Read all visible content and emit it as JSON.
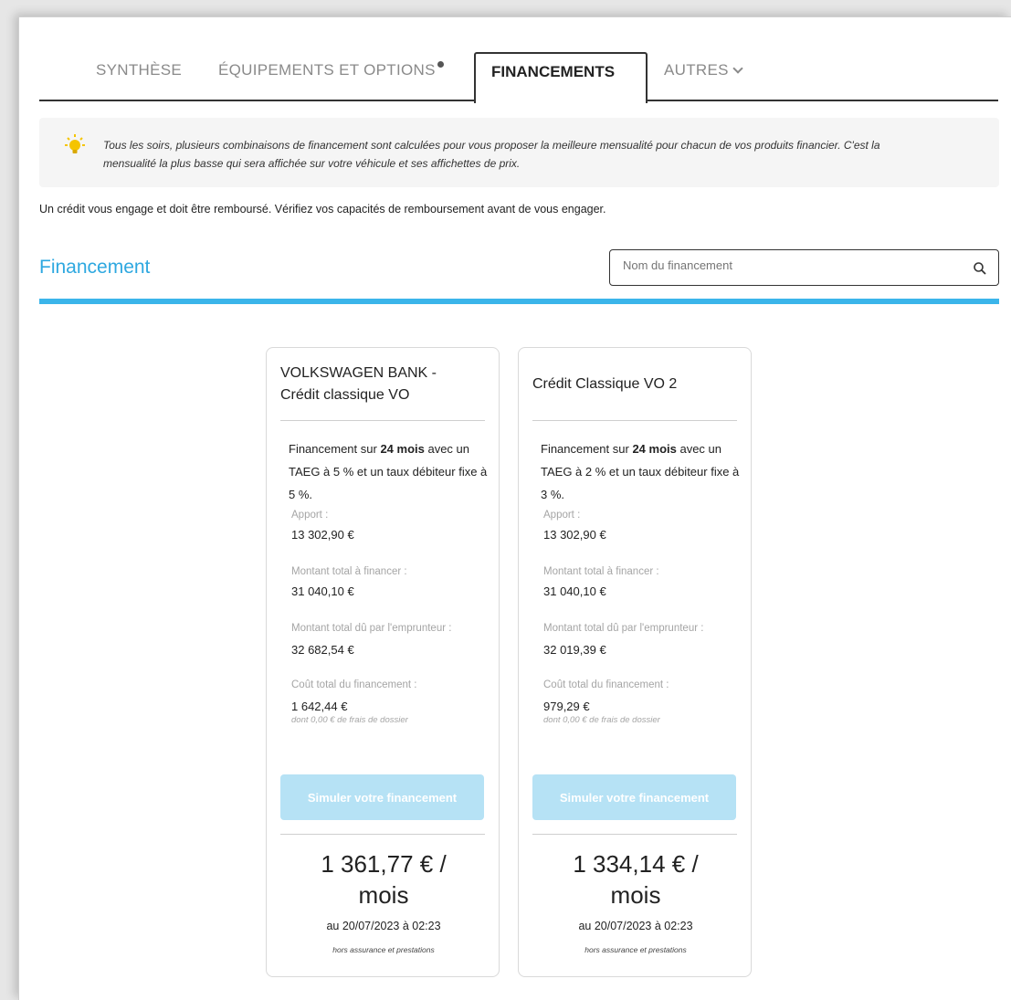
{
  "tabs": {
    "synthese": "SYNTHÈSE",
    "equipements": "ÉQUIPEMENTS ET OPTIONS",
    "financements": "FINANCEMENTS",
    "autres": "AUTRES"
  },
  "info": {
    "line1": "Tous les soirs, plusieurs combinaisons de financement sont calculées pour vous proposer la meilleure mensualité pour chacun de vos produits financier. C'est la",
    "line2": "mensualité la plus basse qui sera affichée sur votre véhicule et ses affichettes de prix."
  },
  "disclaimer": "Un crédit vous engage et doit être remboursé. Vérifiez vos capacités de remboursement avant de vous engager.",
  "section_title": "Financement",
  "search": {
    "placeholder": "Nom du financement"
  },
  "colors": {
    "accent": "#3bb5ea",
    "button_disabled": "#b6e2f5",
    "title": "#2ea8e0"
  },
  "cards": [
    {
      "title_line1": "VOLKSWAGEN BANK -",
      "title_line2": "Crédit classique VO",
      "desc_prefix": "Financement sur ",
      "duration": "24 mois",
      "desc_mid": " avec un TAEG à ",
      "taeg": "5 %",
      "desc_suffix": " et un taux débiteur fixe à 5 %.",
      "apport_label": "Apport :",
      "apport_value": "13 302,90 €",
      "montant_label": "Montant total à financer :",
      "montant_value": "31 040,10 €",
      "du_label": "Montant total dû par l'emprunteur :",
      "du_value": "32 682,54 €",
      "cout_label": "Coût total du financement :",
      "cout_value": "1 642,44 €",
      "cout_note": "dont 0,00 € de frais de dossier",
      "button": "Simuler votre financement",
      "price_line1": "1 361,77 € /",
      "price_line2": "mois",
      "date": "au 20/07/2023 à 02:23",
      "note": "hors assurance et prestations"
    },
    {
      "title_line1": "Crédit Classique VO 2",
      "title_line2": "",
      "desc_prefix": "Financement sur ",
      "duration": "24 mois",
      "desc_mid": " avec un TAEG à ",
      "taeg": "2 %",
      "desc_suffix": " et un taux débiteur fixe à 3 %.",
      "apport_label": "Apport :",
      "apport_value": "13 302,90 €",
      "montant_label": "Montant total à financer :",
      "montant_value": "31 040,10 €",
      "du_label": "Montant total dû par l'emprunteur :",
      "du_value": "32 019,39 €",
      "cout_label": "Coût total du financement :",
      "cout_value": "979,29 €",
      "cout_note": "dont 0,00 € de frais de dossier",
      "button": "Simuler votre financement",
      "price_line1": "1 334,14 € /",
      "price_line2": "mois",
      "date": "au 20/07/2023 à 02:23",
      "note": "hors assurance et prestations"
    }
  ]
}
